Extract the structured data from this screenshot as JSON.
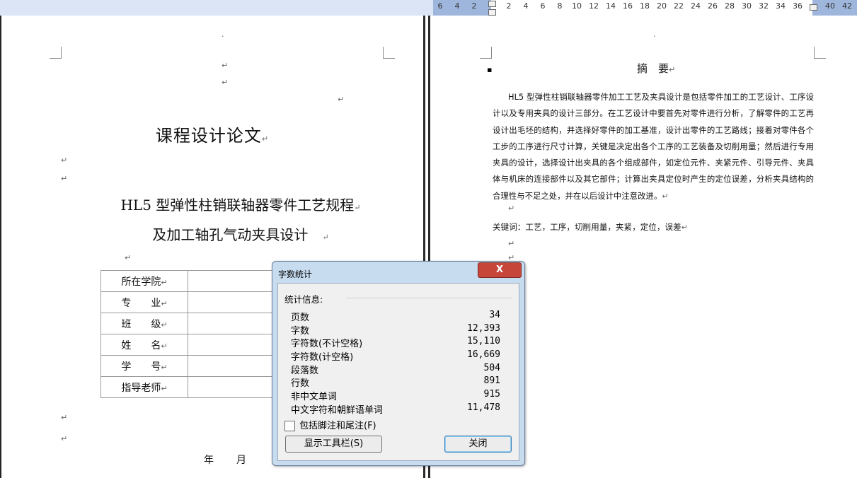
{
  "ruler": {
    "left_ticks": [
      "6",
      "4",
      "2"
    ],
    "right_ticks": [
      "2",
      "4",
      "6",
      "8",
      "10",
      "12",
      "14",
      "16",
      "18",
      "20",
      "22",
      "24",
      "26",
      "28",
      "30",
      "32",
      "34",
      "36",
      "40",
      "42"
    ]
  },
  "cover": {
    "title": "课程设计论文",
    "subtitle_line1": "HL5 型弹性柱销联轴器零件工艺规程",
    "subtitle_line2": "及加工轴孔气动夹具设计",
    "table_labels": [
      "所在学院",
      "专　　业",
      "班　　级",
      "姓　　名",
      "学　　号",
      "指导老师"
    ],
    "year_label": "年",
    "month_label": "月"
  },
  "abstract": {
    "title": "摘　要",
    "body": "HL5 型弹性柱销联轴器零件加工工艺及夹具设计是包括零件加工的工艺设计、工序设计以及专用夹具的设计三部分。在工艺设计中要首先对零件进行分析，了解零件的工艺再设计出毛坯的结构，并选择好零件的加工基准，设计出零件的工艺路线；接着对零件各个工步的工序进行尺寸计算，关键是决定出各个工序的工艺装备及切削用量；然后进行专用夹具的设计，选择设计出夹具的各个组成部件，如定位元件、夹紧元件、引导元件、夹具体与机床的连接部件以及其它部件；计算出夹具定位时产生的定位误差，分析夹具结构的合理性与不足之处，并在以后设计中注意改进。",
    "keywords": "关键词：工艺，工序，切削用量，夹紧，定位，误差"
  },
  "dialog": {
    "title": "字数统计",
    "close_glyph": "X",
    "group_label": "统计信息:",
    "stats": [
      {
        "label": "页数",
        "value": "34"
      },
      {
        "label": "字数",
        "value": "12,393"
      },
      {
        "label": "字符数(不计空格)",
        "value": "15,110"
      },
      {
        "label": "字符数(计空格)",
        "value": "16,669"
      },
      {
        "label": "段落数",
        "value": "504"
      },
      {
        "label": "行数",
        "value": "891"
      },
      {
        "label": "非中文单词",
        "value": "915"
      },
      {
        "label": "中文字符和朝鲜语单词",
        "value": "11,478"
      }
    ],
    "checkbox_label": "包括脚注和尾注(F)",
    "show_toolbar_label": "显示工具栏(S)",
    "close_label": "关闭"
  }
}
